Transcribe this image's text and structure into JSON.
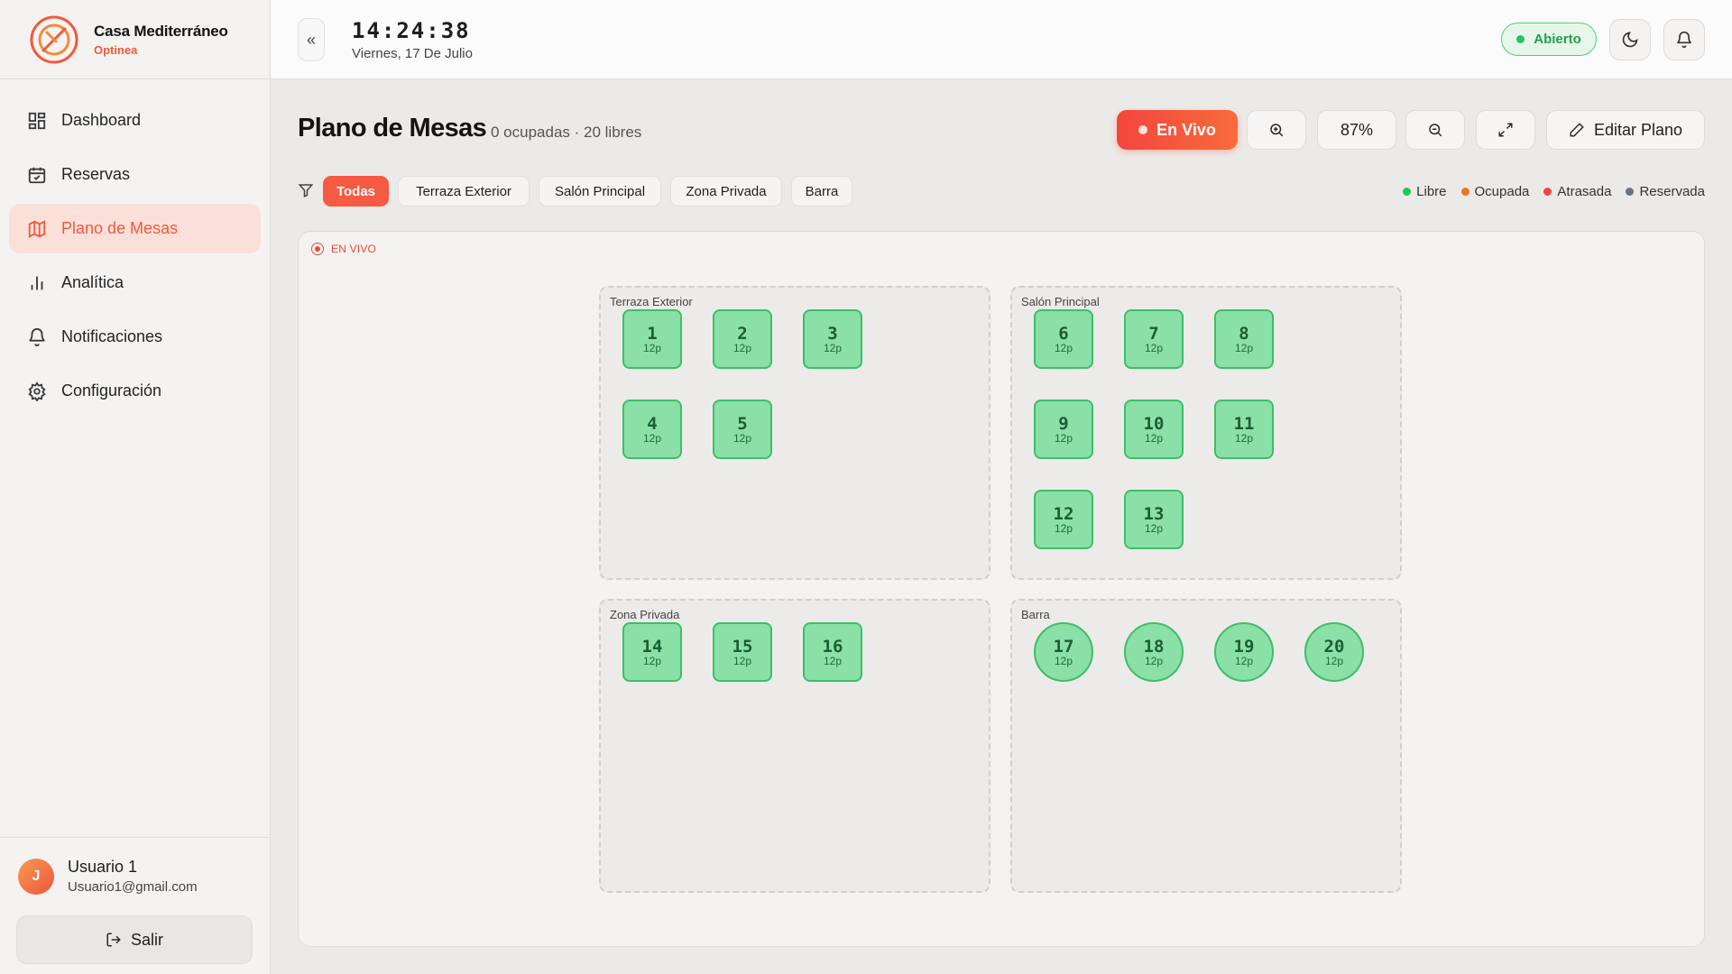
{
  "brand": {
    "name": "Casa Mediterráneo",
    "sub": "Optinea"
  },
  "nav": [
    {
      "label": "Dashboard",
      "icon": "grid-icon"
    },
    {
      "label": "Reservas",
      "icon": "calendar-icon"
    },
    {
      "label": "Plano de Mesas",
      "icon": "map-icon",
      "active": true
    },
    {
      "label": "Analítica",
      "icon": "bar-chart-icon"
    },
    {
      "label": "Notificaciones",
      "icon": "bell-icon"
    },
    {
      "label": "Configuración",
      "icon": "gear-icon"
    }
  ],
  "user": {
    "initial": "J",
    "name": "Usuario 1",
    "email": "Usuario1@gmail.com",
    "logout_label": "Salir"
  },
  "topbar": {
    "collapse_glyph": "«",
    "time": "14:24:38",
    "date": "Viernes, 17 De Julio",
    "status_label": "Abierto"
  },
  "page": {
    "title": "Plano de Mesas",
    "subtitle": "0 ocupadas · 20 libres"
  },
  "toolbar": {
    "live_label": "En Vivo",
    "zoom_level": "87%",
    "edit_label": "Editar Plano"
  },
  "filters": [
    "Todas",
    "Terraza Exterior",
    "Salón Principal",
    "Zona Privada",
    "Barra"
  ],
  "active_filter": "Todas",
  "legend": [
    {
      "label": "Libre",
      "color": "#22c55e"
    },
    {
      "label": "Ocupada",
      "color": "#f97316"
    },
    {
      "label": "Atrasada",
      "color": "#ef4444"
    },
    {
      "label": "Reservada",
      "color": "#6b7280"
    }
  ],
  "canvas": {
    "live_badge": "EN VIVO"
  },
  "zones": [
    {
      "name": "Terraza Exterior",
      "tables": [
        {
          "num": "1",
          "cap": "12p",
          "status": "Libre",
          "shape": "square"
        },
        {
          "num": "2",
          "cap": "12p",
          "status": "Libre",
          "shape": "square"
        },
        {
          "num": "3",
          "cap": "12p",
          "status": "Libre",
          "shape": "square"
        },
        {
          "num": "4",
          "cap": "12p",
          "status": "Libre",
          "shape": "square"
        },
        {
          "num": "5",
          "cap": "12p",
          "status": "Libre",
          "shape": "square"
        }
      ]
    },
    {
      "name": "Salón Principal",
      "tables": [
        {
          "num": "6",
          "cap": "12p",
          "status": "Libre",
          "shape": "square"
        },
        {
          "num": "7",
          "cap": "12p",
          "status": "Libre",
          "shape": "square"
        },
        {
          "num": "8",
          "cap": "12p",
          "status": "Libre",
          "shape": "square"
        },
        {
          "num": "9",
          "cap": "12p",
          "status": "Libre",
          "shape": "square"
        },
        {
          "num": "10",
          "cap": "12p",
          "status": "Libre",
          "shape": "square"
        },
        {
          "num": "11",
          "cap": "12p",
          "status": "Libre",
          "shape": "square"
        },
        {
          "num": "12",
          "cap": "12p",
          "status": "Libre",
          "shape": "square"
        },
        {
          "num": "13",
          "cap": "12p",
          "status": "Libre",
          "shape": "square"
        }
      ]
    },
    {
      "name": "Zona Privada",
      "tables": [
        {
          "num": "14",
          "cap": "12p",
          "status": "Libre",
          "shape": "square"
        },
        {
          "num": "15",
          "cap": "12p",
          "status": "Libre",
          "shape": "square"
        },
        {
          "num": "16",
          "cap": "12p",
          "status": "Libre",
          "shape": "square"
        }
      ]
    },
    {
      "name": "Barra",
      "tables": [
        {
          "num": "17",
          "cap": "12p",
          "status": "Libre",
          "shape": "round"
        },
        {
          "num": "18",
          "cap": "12p",
          "status": "Libre",
          "shape": "round"
        },
        {
          "num": "19",
          "cap": "12p",
          "status": "Libre",
          "shape": "round"
        },
        {
          "num": "20",
          "cap": "12p",
          "status": "Libre",
          "shape": "round"
        }
      ]
    }
  ]
}
